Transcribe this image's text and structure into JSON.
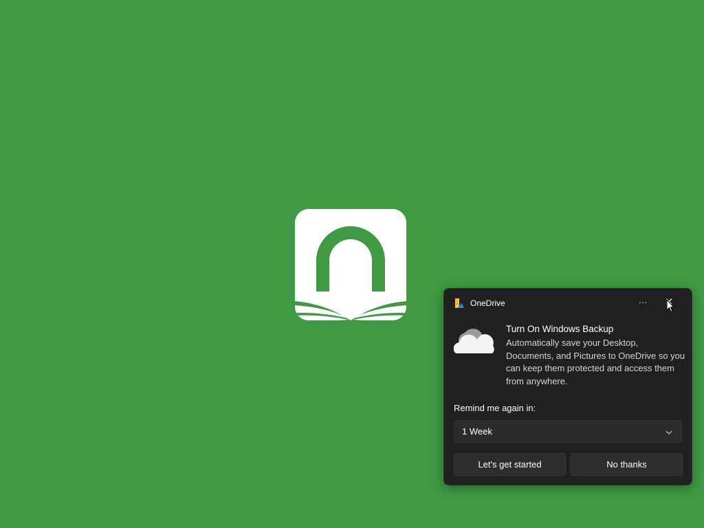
{
  "colors": {
    "desktop_bg": "#3f9a43",
    "logo_fg": "#ffffff",
    "toast_bg": "#202020",
    "button_bg": "#2d2d2d",
    "text_primary": "#ffffff",
    "text_secondary": "#d4d4d4"
  },
  "desktop": {
    "app_logo_icon": "book-arch-logo"
  },
  "toast": {
    "app_icon": "onedrive-icon",
    "app_name": "OneDrive",
    "more_icon": "more-options-icon",
    "more_label": "···",
    "close_icon": "close-icon",
    "close_label": "✕",
    "illustration_icon": "cloud-icon",
    "title": "Turn On Windows Backup",
    "body": "Automatically save your Desktop, Documents, and Pictures to OneDrive so you can keep them protected and access them from anywhere.",
    "remind_label": "Remind me again in:",
    "remind_value": "1 Week",
    "primary_button": "Let's get started",
    "secondary_button": "No thanks"
  }
}
